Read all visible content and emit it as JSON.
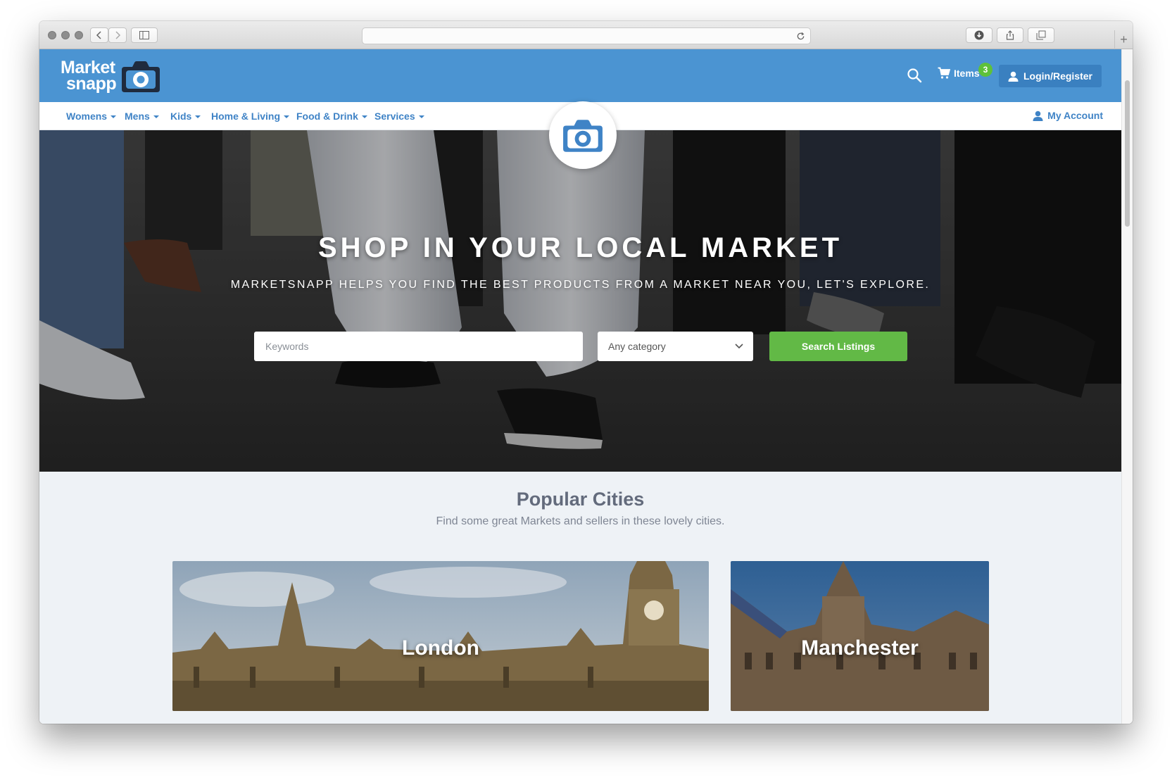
{
  "site": {
    "logo_line1": "Market",
    "logo_line2": "snapp",
    "brand_color": "#4b94d2"
  },
  "header": {
    "cart_label": "Items",
    "cart_count": "3",
    "login_label": "Login/Register"
  },
  "nav": {
    "items": [
      {
        "label": "Womens"
      },
      {
        "label": "Mens"
      },
      {
        "label": "Kids"
      },
      {
        "label": "Home & Living"
      },
      {
        "label": "Food & Drink"
      },
      {
        "label": "Services"
      }
    ],
    "account_label": "My Account"
  },
  "hero": {
    "title": "SHOP IN YOUR LOCAL MARKET",
    "subtitle": "MARKETSNAPP HELPS YOU FIND THE BEST PRODUCTS FROM A MARKET NEAR YOU, LET'S EXPLORE.",
    "keywords_placeholder": "Keywords",
    "category_value": "Any category",
    "search_button": "Search Listings",
    "search_button_color": "#62b946"
  },
  "popular": {
    "title": "Popular Cities",
    "subtitle": "Find some great Markets and sellers in these lovely cities.",
    "cities": [
      {
        "name": "London"
      },
      {
        "name": "Manchester"
      }
    ]
  }
}
